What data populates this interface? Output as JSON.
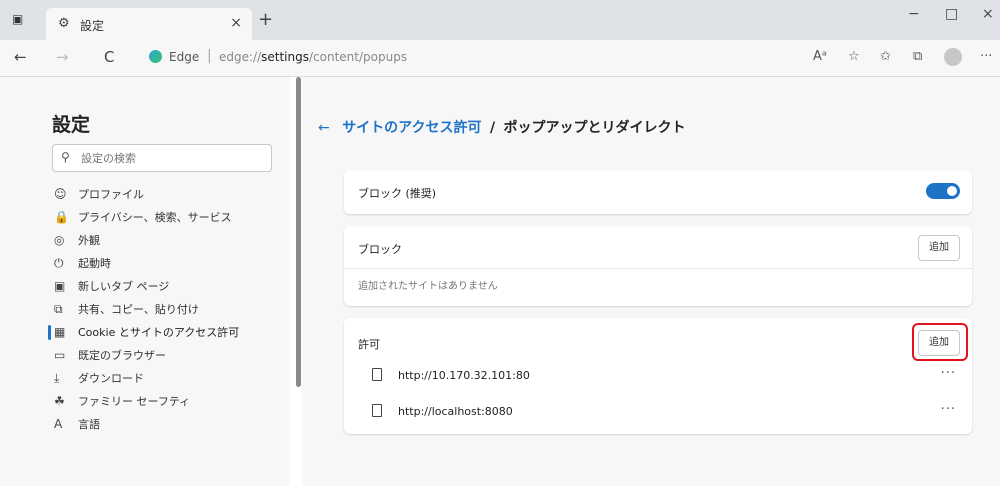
{
  "window": {
    "tab_title": "設定",
    "new_tab_symbol": "+",
    "tab_close_symbol": "×",
    "minimize_symbol": "−",
    "maximize_symbol": "□",
    "close_symbol": "×"
  },
  "toolbar": {
    "back_symbol": "←",
    "forward_symbol": "→",
    "refresh_symbol": "C",
    "brand": "Edge",
    "url_prefix": "edge://",
    "url_bold": "settings",
    "url_rest": "/content/popups",
    "more_symbol": "···"
  },
  "sidebar": {
    "title": "設定",
    "search_placeholder": "設定の検索",
    "items": [
      {
        "label": "プロファイル",
        "icon": "profile-icon",
        "glyph": "☺"
      },
      {
        "label": "プライバシー、検索、サービス",
        "icon": "lock-icon",
        "glyph": "🔒"
      },
      {
        "label": "外観",
        "icon": "appearance-icon",
        "glyph": "◎"
      },
      {
        "label": "起動時",
        "icon": "power-icon",
        "glyph": "⏻"
      },
      {
        "label": "新しいタブ ページ",
        "icon": "new-tab-icon",
        "glyph": "▣"
      },
      {
        "label": "共有、コピー、貼り付け",
        "icon": "share-icon",
        "glyph": "⧉"
      },
      {
        "label": "Cookie とサイトのアクセス許可",
        "icon": "cookie-icon",
        "glyph": "▦",
        "active": true
      },
      {
        "label": "既定のブラウザー",
        "icon": "browser-icon",
        "glyph": "▭"
      },
      {
        "label": "ダウンロード",
        "icon": "download-icon",
        "glyph": "⤓"
      },
      {
        "label": "ファミリー セーフティ",
        "icon": "family-icon",
        "glyph": "☘"
      },
      {
        "label": "言語",
        "icon": "language-icon",
        "glyph": "A"
      }
    ]
  },
  "main": {
    "back_symbol": "←",
    "breadcrumb_link": "サイトのアクセス許可",
    "breadcrumb_sep": "/",
    "breadcrumb_current": "ポップアップとリダイレクト",
    "block_recommended_label": "ブロック (推奨)",
    "block_toggle_on": true,
    "block_section": {
      "label": "ブロック",
      "add_label": "追加",
      "empty_message": "追加されたサイトはありません"
    },
    "allow_section": {
      "label": "許可",
      "add_label": "追加",
      "sites": [
        {
          "url": "http://10.170.32.101:80"
        },
        {
          "url": "http://localhost:8080"
        }
      ],
      "more_symbol": "···"
    }
  },
  "colors": {
    "accent": "#1e73c8",
    "highlight_box": "#e0141e"
  }
}
